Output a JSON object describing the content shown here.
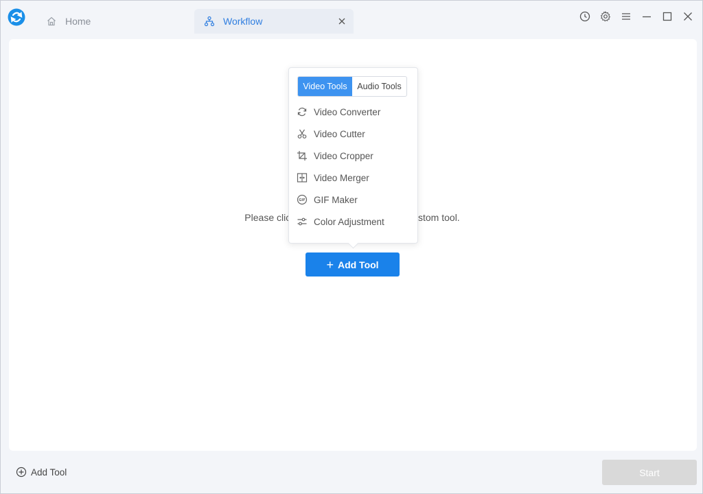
{
  "tabs": {
    "home": {
      "label": "Home"
    },
    "workflow": {
      "label": "Workflow"
    }
  },
  "icons": {
    "logo": "app-logo-icon",
    "home": "home-icon",
    "workflow": "workflow-icon",
    "close": "close-icon",
    "history": "clock-icon",
    "settings": "gear-icon",
    "menu": "menu-icon",
    "minimize": "minimize-icon",
    "maximize": "maximize-icon",
    "window_close": "close-icon"
  },
  "main": {
    "hint_left": "Please click",
    "hint_right": "ustom tool.",
    "add_tool_label": "Add Tool"
  },
  "dropdown": {
    "tabs": [
      {
        "label": "Video Tools",
        "active": true
      },
      {
        "label": "Audio Tools",
        "active": false
      }
    ],
    "items": [
      {
        "label": "Video Converter",
        "icon": "convert-icon"
      },
      {
        "label": "Video Cutter",
        "icon": "scissors-icon"
      },
      {
        "label": "Video Cropper",
        "icon": "crop-icon"
      },
      {
        "label": "Video Merger",
        "icon": "merge-icon"
      },
      {
        "label": "GIF Maker",
        "icon": "gif-icon"
      },
      {
        "label": "Color Adjustment",
        "icon": "sliders-icon"
      }
    ]
  },
  "footer": {
    "add_tool_label": "Add Tool",
    "start_label": "Start"
  },
  "colors": {
    "accent": "#1a82ea",
    "tab_active_text": "#2f7ee0",
    "segment_active": "#3d93f0",
    "disabled_button": "#d9d9d9"
  }
}
